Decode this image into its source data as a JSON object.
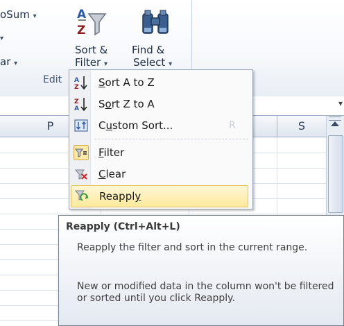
{
  "ribbon": {
    "autosum_label": "oSum",
    "fill_arrow": "▾",
    "clear_label": "ar",
    "dropdown_arrow": "▾",
    "sort_filter": {
      "line1": "Sort &",
      "line2": "Filter"
    },
    "find_select": {
      "line1": "Find &",
      "line2": "Select"
    },
    "group_label": "Edit"
  },
  "columns": [
    "P",
    "S"
  ],
  "ghost_column": "R",
  "menu": {
    "items": [
      {
        "pre": "",
        "mnemonic": "S",
        "post": "ort A to Z",
        "icon": "sort-a-to-z-icon"
      },
      {
        "pre": "S",
        "mnemonic": "o",
        "post": "rt Z to A",
        "icon": "sort-z-to-a-icon"
      },
      {
        "pre": "C",
        "mnemonic": "u",
        "post": "stom Sort...",
        "icon": "custom-sort-icon"
      },
      {
        "pre": "",
        "mnemonic": "F",
        "post": "ilter",
        "icon": "filter-icon"
      },
      {
        "pre": "",
        "mnemonic": "C",
        "post": "lear",
        "icon": "clear-filter-icon"
      },
      {
        "pre": "Reappl",
        "mnemonic": "y",
        "post": "",
        "icon": "reapply-icon"
      }
    ]
  },
  "tooltip": {
    "title": "Reapply (Ctrl+Alt+L)",
    "para1": "Reapply the filter and sort in the current range.",
    "para2": "New or modified data in the column won't be filtered or sorted until you click Reapply."
  },
  "colors": {
    "hover_bg": "#fce99c",
    "hover_border": "#e5c365",
    "filter_active_bg": "#fde9a8"
  }
}
